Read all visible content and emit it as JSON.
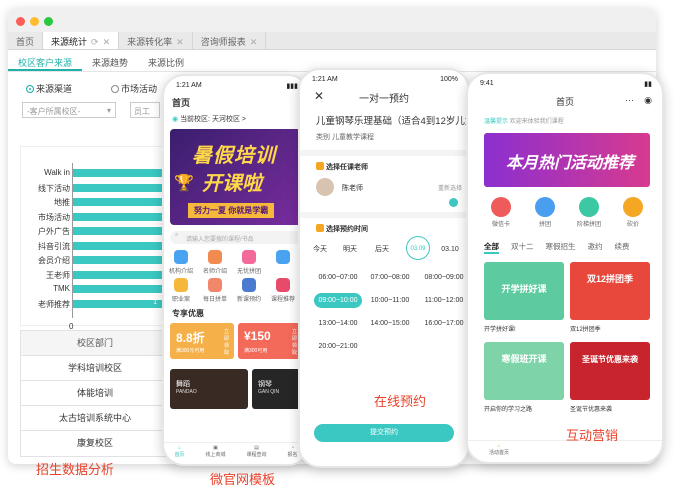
{
  "window": {
    "tabs": [
      {
        "label": "首页"
      },
      {
        "label": "来源统计",
        "active": true
      },
      {
        "label": "来源转化率"
      },
      {
        "label": "咨询师报表"
      }
    ],
    "subtabs": [
      "校区客户来源",
      "来源趋势",
      "来源比例"
    ],
    "filters": {
      "radio_a": "来源渠道",
      "radio_b": "市场活动",
      "campus_placeholder": "-客户所属校区-",
      "input_placeholder": "员工"
    }
  },
  "chart_data": {
    "type": "bar",
    "orientation": "horizontal",
    "categories": [
      "Walk in",
      "线下活动",
      "地推",
      "市场活动",
      "户外广告",
      "抖音引流",
      "会员介绍",
      "王老师",
      "TMK",
      "老师推荐"
    ],
    "values": [
      null,
      null,
      null,
      null,
      null,
      null,
      null,
      null,
      null,
      1
    ],
    "xlabel": "",
    "ylabel": "",
    "xticks": [
      "0"
    ],
    "colors": {
      "bar": "#3cc8c2"
    }
  },
  "table": {
    "header": "校区部门",
    "rows": [
      "学科培训校区",
      "体能培训",
      "太古培训系统中心",
      "康复校区"
    ]
  },
  "phone1": {
    "time": "1:21 AM",
    "title": "首页",
    "campus": "当前校区: 天河校区 >",
    "banner_lines": [
      "暑假培训",
      "开课啦"
    ],
    "banner_sub": "努力一夏 你就是学霸",
    "search_placeholder": "请输入您要搜的课程/书品",
    "icons": [
      "机构介绍",
      "名师介绍",
      "无忧拼团",
      "",
      "职业案",
      "每日拼单",
      "新课预约",
      "课程推荐"
    ],
    "section": "专享优惠",
    "coupon1": "8.8折",
    "coupon2": "¥150",
    "coupon1_btn": "立即领取",
    "coupon2_btn": "立即领取",
    "coupon1_sub": "满300元可用",
    "coupon2_sub": "满300可用",
    "card1": "舞蹈",
    "card1_en": "PANDAO",
    "card2": "钢琴",
    "card2_en": "GAN QIN",
    "nav": [
      "首页",
      "线上商城",
      "课程查询",
      "报名"
    ]
  },
  "phone2": {
    "time": "1:21 AM",
    "battery": "100%",
    "title": "一对一预约",
    "course": "儿童钢琴乐理基础（适合4到12岁儿童）",
    "category": "类别  儿童教学课程",
    "step1": "选择任课老师",
    "teacher": "陈老师",
    "reselect": "重新选择",
    "step2": "选择预约时间",
    "days": [
      "今天",
      "明天",
      "后天",
      "03.09",
      "03.10"
    ],
    "slots": [
      "06:00~07:00",
      "07:00~08:00",
      "08:00~09:00",
      "09:00~10:00",
      "10:00~11:00",
      "11:00~12:00",
      "13:00~14:00",
      "14:00~15:00",
      "16:00~17:00",
      "20:00~21:00"
    ],
    "submit": "提交预约"
  },
  "phone3": {
    "time": "9:41",
    "title": "首页",
    "notice": "温馨提示",
    "notice_text": "欢迎来体验我们课程",
    "banner": "本月热门活动推荐",
    "icons": [
      "微信卡",
      "拼团",
      "阶梯拼团",
      "砍价"
    ],
    "tabs": [
      "全部",
      "双十二",
      "寒假招生",
      "邀约",
      "续费"
    ],
    "cards": [
      {
        "img": "开学拼好课",
        "label": "开学拼好课!"
      },
      {
        "img": "双12拼团季",
        "label": "双12拼团季"
      },
      {
        "img": "寒假班开课",
        "label": "开启你的学习之路"
      },
      {
        "img": "圣诞节优惠来袭",
        "label": "圣诞节优惠来袭"
      }
    ],
    "nav": [
      "活动首页"
    ]
  },
  "captions": [
    "招生数据分析",
    "微官网模板",
    "在线预约",
    "互动营销"
  ]
}
